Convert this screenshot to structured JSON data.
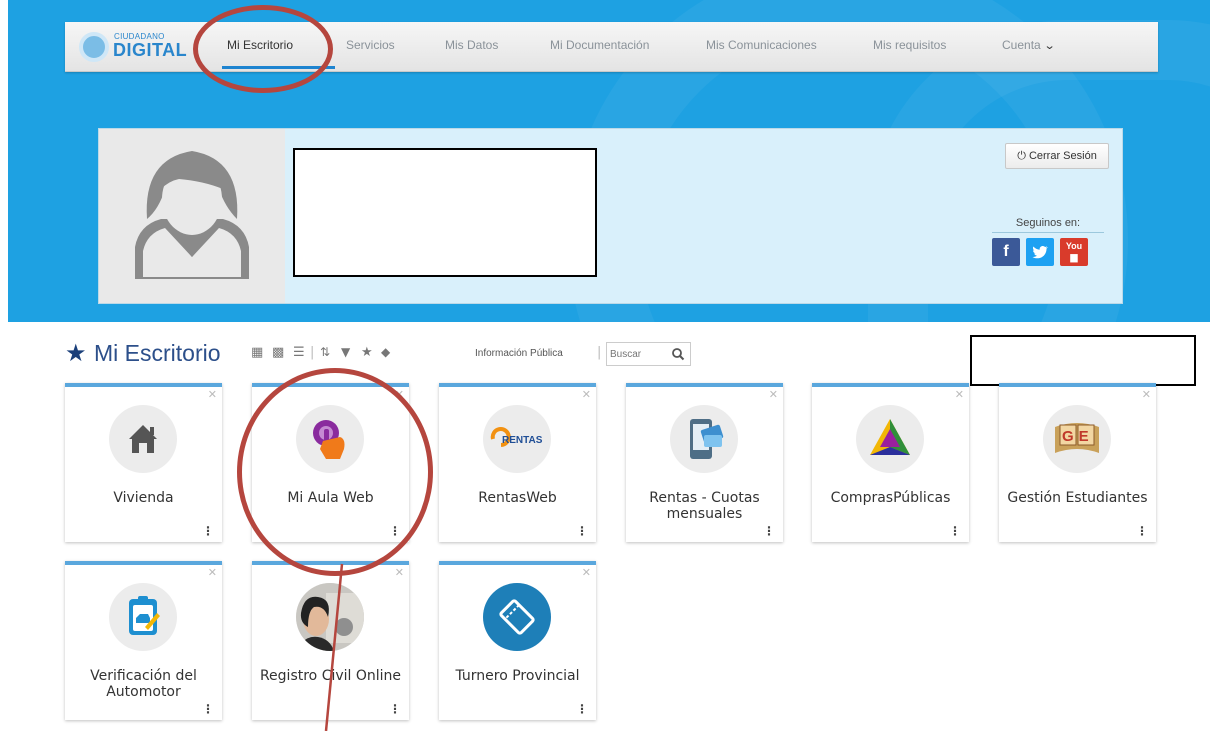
{
  "nav": {
    "logo_small": "CIUDADANO",
    "logo_big": "DIGITAL",
    "items": [
      {
        "label": "Mi Escritorio"
      },
      {
        "label": "Servicios"
      },
      {
        "label": "Mis Datos"
      },
      {
        "label": "Mi Documentación"
      },
      {
        "label": "Mis Comunicaciones"
      },
      {
        "label": "Mis requisitos"
      },
      {
        "label": "Cuenta"
      }
    ]
  },
  "profile": {
    "logout_label": "Cerrar Sesión",
    "follow_label": "Seguinos en:",
    "social": [
      "facebook-icon",
      "twitter-icon",
      "youtube-icon"
    ]
  },
  "toolbar": {
    "title": "Mi Escritorio",
    "info_label": "Información Pública",
    "search_placeholder": "Buscar"
  },
  "tiles": [
    {
      "label": "Vivienda",
      "icon": "house-icon"
    },
    {
      "label": "Mi Aula Web",
      "icon": "touch-button-icon"
    },
    {
      "label": "RentasWeb",
      "icon": "rentas-logo-icon"
    },
    {
      "label": "Rentas - Cuotas mensuales",
      "icon": "phone-card-icon"
    },
    {
      "label": "ComprasPúblicas",
      "icon": "triangle-logo-icon"
    },
    {
      "label": "Gestión Estudiantes",
      "icon": "ge-book-icon"
    },
    {
      "label": "Verificación del Automotor",
      "icon": "clipboard-car-icon"
    },
    {
      "label": "Registro Civil Online",
      "icon": "id-photo-icon"
    },
    {
      "label": "Turnero Provincial",
      "icon": "ticket-icon"
    }
  ],
  "rentas_logo_text": "RENTAS",
  "ge_text": "GE",
  "colors": {
    "banner": "#1ea1e2",
    "nav_accent": "#1e84d0",
    "tile_accent": "#5aa7dd",
    "annotation": "#b5463e"
  }
}
